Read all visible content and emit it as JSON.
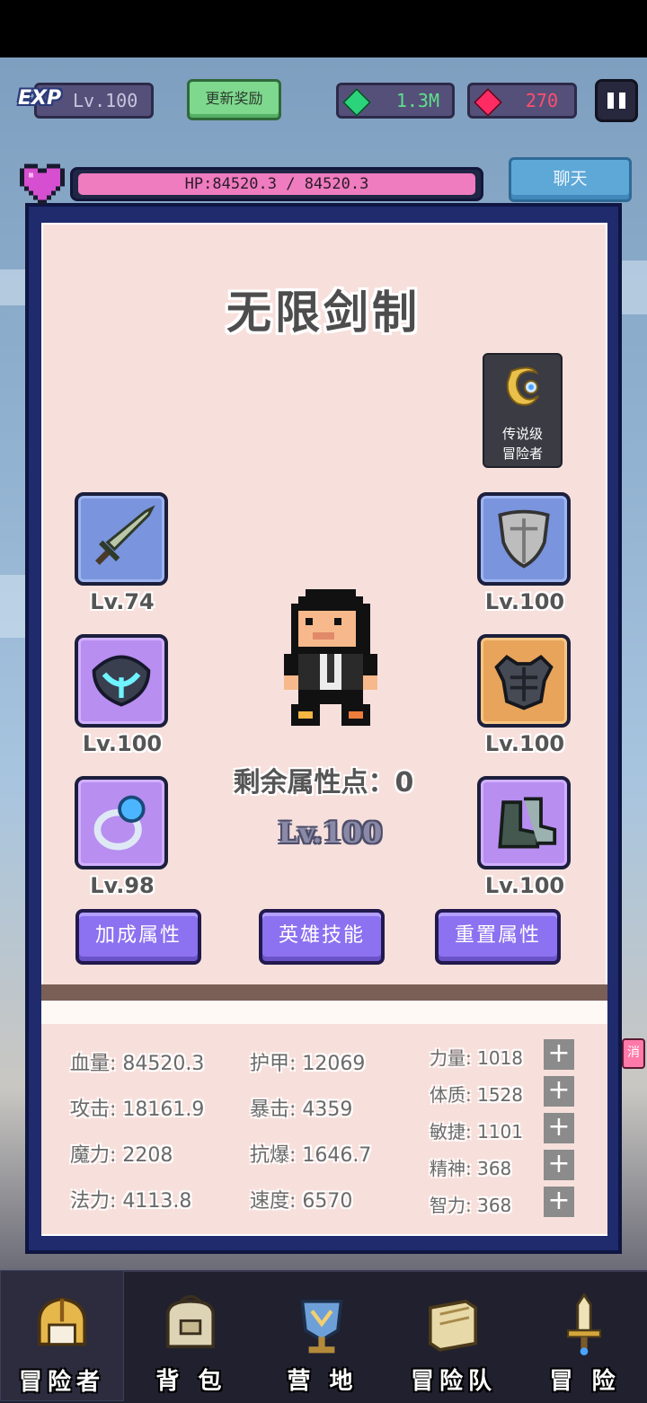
{
  "header": {
    "exp_badge": "EXP",
    "level": "Lv.100",
    "reward_button": "更新奖励",
    "gems": "1.3M",
    "rubies": "270",
    "hp_text": "HP:84520.3 / 84520.3",
    "hp_fraction": 1.0,
    "chat_button": "聊天"
  },
  "panel": {
    "title": "无限剑制",
    "rank_card": {
      "line1": "传说级",
      "line2": "冒险者"
    },
    "equipment": [
      {
        "slot": "weapon",
        "level": "Lv.74"
      },
      {
        "slot": "shield",
        "level": "Lv.100"
      },
      {
        "slot": "amulet",
        "level": "Lv.100"
      },
      {
        "slot": "armor",
        "level": "Lv.100"
      },
      {
        "slot": "ring",
        "level": "Lv.98"
      },
      {
        "slot": "boots",
        "level": "Lv.100"
      }
    ],
    "points_label": "剩余属性点：0",
    "hero_level": "Lv.100",
    "buttons": {
      "bonus": "加成属性",
      "skills": "英雄技能",
      "reset": "重置属性"
    }
  },
  "stats": {
    "col1": [
      "血量: 84520.3",
      "攻击: 18161.9",
      "魔力: 2208",
      "法力: 4113.8"
    ],
    "col2": [
      "护甲: 12069",
      "暴击: 4359",
      "抗爆: 1646.7",
      "速度: 6570"
    ],
    "attributes": [
      "力量: 1018",
      "体质: 1528",
      "敏捷: 1101",
      "精神: 368",
      "智力: 368"
    ],
    "plus": "+"
  },
  "side_tab": "消",
  "nav": [
    {
      "label": "冒险者",
      "icon": "helmet-icon"
    },
    {
      "label": "背 包",
      "icon": "backpack-icon"
    },
    {
      "label": "营 地",
      "icon": "camp-icon"
    },
    {
      "label": "冒险队",
      "icon": "book-icon"
    },
    {
      "label": "冒 险",
      "icon": "sword-icon"
    }
  ],
  "colors": {
    "panel_bg": "#f7e0dc",
    "panel_border": "#1f2b6d",
    "hp_fill": "#ee7cbf",
    "action_button": "#8c71f0"
  }
}
